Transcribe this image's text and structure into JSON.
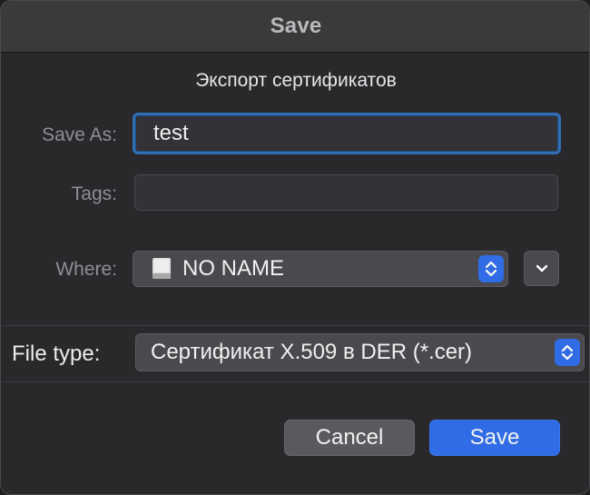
{
  "window": {
    "title": "Save"
  },
  "dialog": {
    "subtitle": "Экспорт сертификатов"
  },
  "save_as": {
    "label": "Save As:",
    "value": "test"
  },
  "tags": {
    "label": "Tags:",
    "value": ""
  },
  "where": {
    "label": "Where:",
    "value": "NO NAME",
    "icon": "drive-icon"
  },
  "file_type": {
    "label": "File type:",
    "value": "Сертификат X.509 в DER (*.cer)"
  },
  "buttons": {
    "cancel": "Cancel",
    "save": "Save"
  },
  "colors": {
    "accent": "#2f6ce5",
    "focus_ring": "#2f6fb3",
    "background": "#29282b"
  }
}
